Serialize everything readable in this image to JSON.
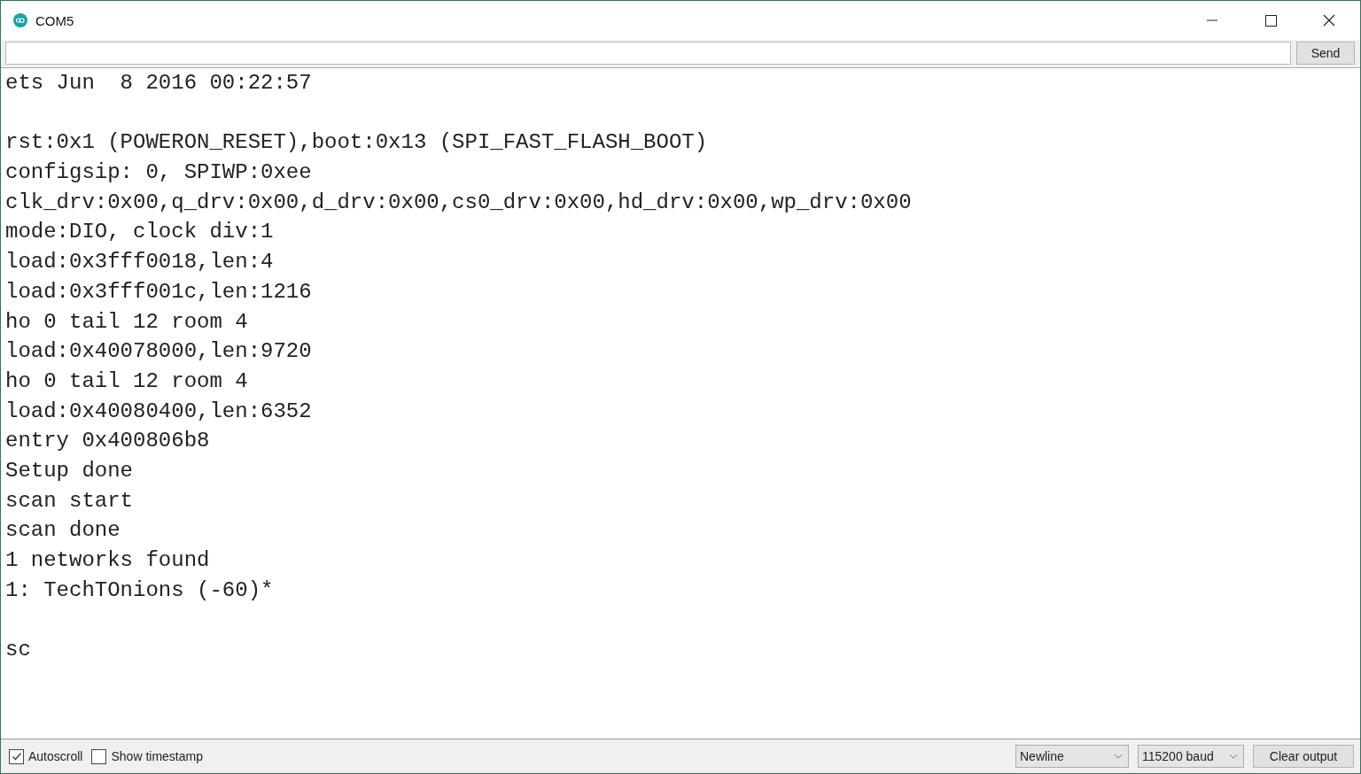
{
  "window": {
    "title": "COM5"
  },
  "send_button": "Send",
  "output_blocks": [
    [
      "ets Jun  8 2016 00:22:57"
    ],
    [
      "rst:0x1 (POWERON_RESET),boot:0x13 (SPI_FAST_FLASH_BOOT)",
      "configsip: 0, SPIWP:0xee",
      "clk_drv:0x00,q_drv:0x00,d_drv:0x00,cs0_drv:0x00,hd_drv:0x00,wp_drv:0x00",
      "mode:DIO, clock div:1",
      "load:0x3fff0018,len:4",
      "load:0x3fff001c,len:1216",
      "ho 0 tail 12 room 4",
      "load:0x40078000,len:9720",
      "ho 0 tail 12 room 4",
      "load:0x40080400,len:6352",
      "entry 0x400806b8",
      "Setup done",
      "scan start",
      "scan done",
      "1 networks found",
      "1: TechTOnions (-60)*"
    ],
    [
      "sc"
    ]
  ],
  "options": [
    {
      "label": "Autoscroll",
      "checked": true
    },
    {
      "label": "Show timestamp",
      "checked": false
    }
  ],
  "line_ending": "Newline",
  "baud_rate": "115200 baud",
  "clear_button": "Clear output"
}
